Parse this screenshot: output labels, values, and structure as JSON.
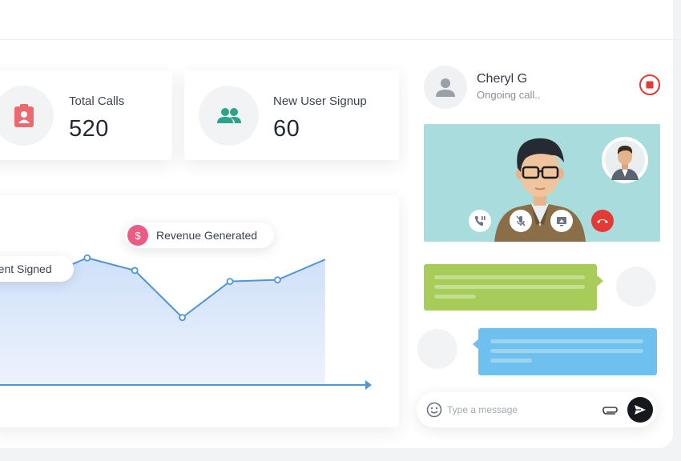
{
  "stats": [
    {
      "label": "Total Calls",
      "value": "520",
      "icon": "contact-card-icon",
      "icon_color": "#ec6a6f"
    },
    {
      "label": "New User Signup",
      "value": "60",
      "icon": "users-icon",
      "icon_color": "#2aa58c"
    }
  ],
  "chart": {
    "annotations": {
      "left": "ment Signed",
      "revenue": "Revenue Generated"
    },
    "revenue_badge": "$",
    "line_color": "#4f95d8",
    "fill_color": "#d4e4fb",
    "dollar_color": "#ec5b84"
  },
  "chart_data": {
    "type": "area",
    "title": "",
    "xlabel": "",
    "ylabel": "",
    "series": [
      {
        "values": [
          74,
          68,
          81,
          73,
          43,
          66,
          67,
          80
        ]
      }
    ],
    "ylim": [
      0,
      100
    ],
    "grid": false
  },
  "call": {
    "caller_name": "Cheryl G",
    "caller_status": "Ongoing call..",
    "buttons": [
      "pause-call-icon",
      "mute-mic-icon",
      "share-screen-icon",
      "end-call-icon"
    ],
    "end_call_color": "#e53935",
    "record_color": "#e53935",
    "video_bg": "#a9dcdc"
  },
  "messages": [
    {
      "from": "self",
      "color": "#a7cc5a",
      "lines": 3
    },
    {
      "from": "other",
      "color": "#6ec0ee",
      "lines": 3
    }
  ],
  "composer": {
    "placeholder": "Type a message"
  }
}
